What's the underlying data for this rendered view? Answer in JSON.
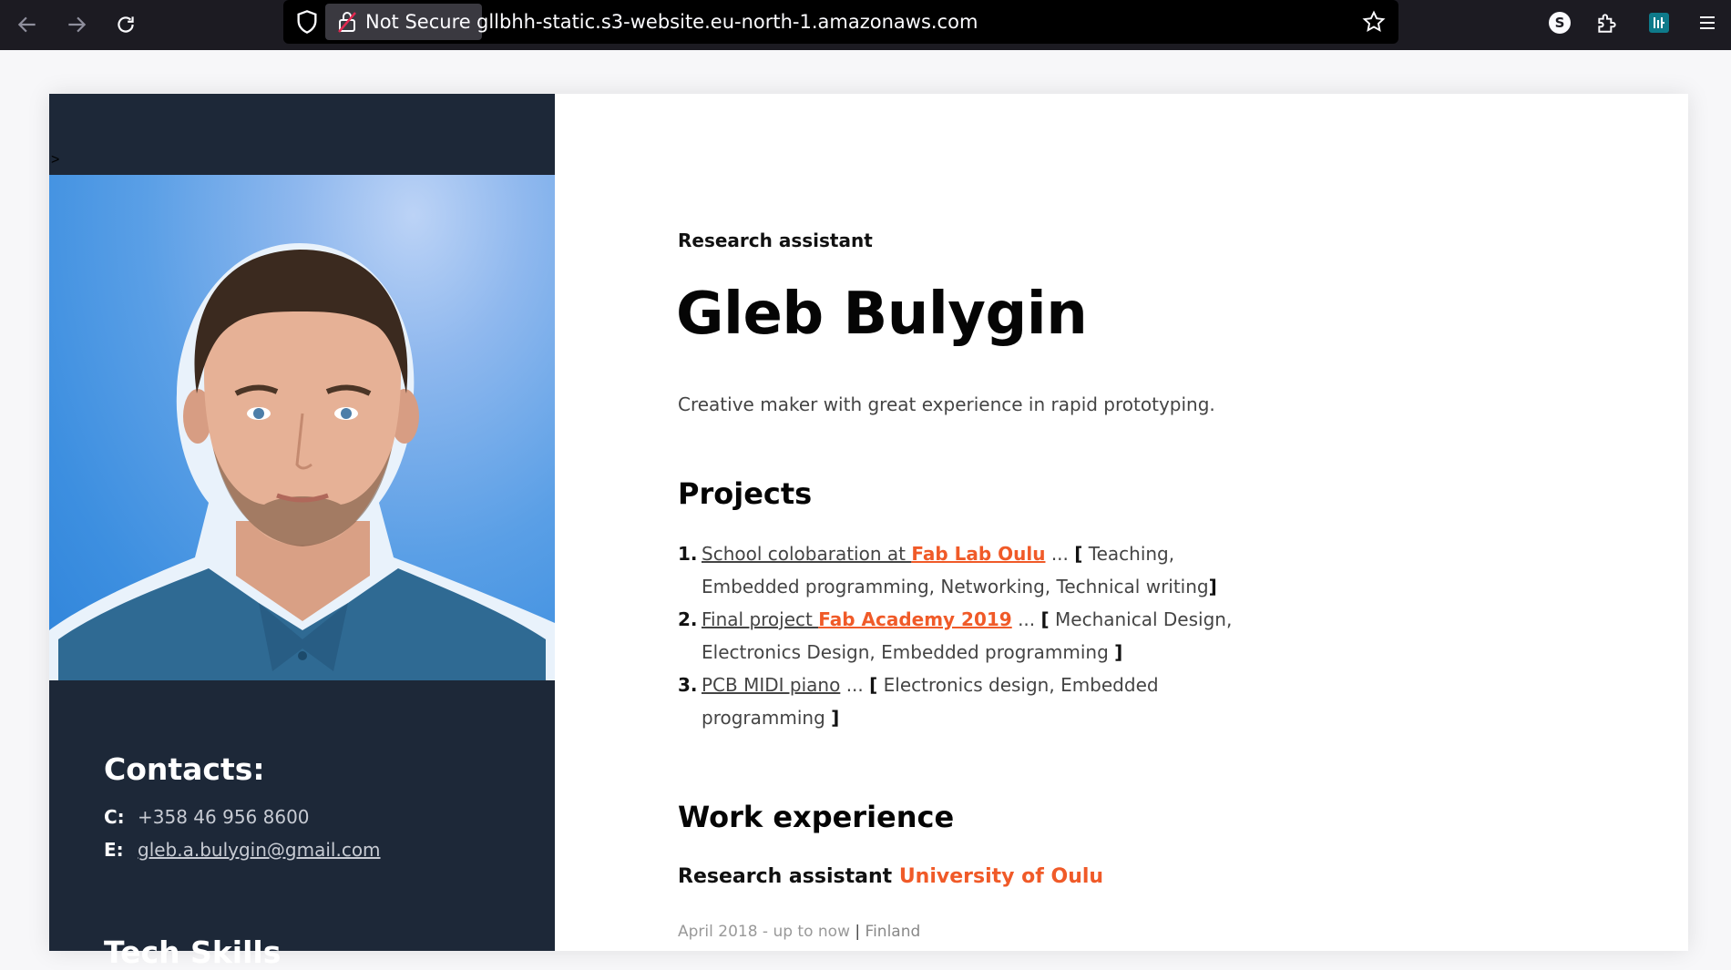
{
  "browser": {
    "not_secure_label": "Not Secure",
    "url": "gllbhh-static.s3-website.eu-north-1.amazonaws.com",
    "profile_initial": "S",
    "colors": {
      "chrome": "#1c1b22",
      "urlbar": "#000000"
    }
  },
  "page": {
    "stray_char": ">",
    "colors": {
      "sidebar": "#1d2838",
      "accent": "#f05a28"
    }
  },
  "sidebar": {
    "contacts_title": "Contacts:",
    "contacts": [
      {
        "key": "C:",
        "value": "+358 46 956 8600"
      },
      {
        "key": "E:",
        "value": "gleb.a.bulygin@gmail.com"
      }
    ],
    "skills_title": "Tech Skills"
  },
  "main": {
    "role": "Research assistant",
    "name": "Gleb Bulygin",
    "tagline": "Creative maker with great experience in rapid prototyping.",
    "projects_title": "Projects",
    "projects": [
      {
        "num": "1.",
        "link": "School colobaration at ",
        "accent": "Fab Lab Oulu",
        "ellipsis": " ... ",
        "open": "[",
        "tags": " Teaching, Embedded programming, Networking, Technical writing",
        "close": "]"
      },
      {
        "num": "2.",
        "link": "Final project ",
        "accent": "Fab Academy 2019",
        "ellipsis": " ... ",
        "open": "[",
        "tags": " Mechanical Design, Electronics Design, Embedded programming ",
        "close": "]"
      },
      {
        "num": "3.",
        "link": "PCB MIDI piano",
        "accent": "",
        "ellipsis": " ... ",
        "open": "[",
        "tags": " Electronics design, Embedded programming ",
        "close": "]"
      }
    ],
    "work_title": "Work experience",
    "job": {
      "title": "Research assistant ",
      "org": "University of Oulu",
      "dates": "April 2018 - up to now",
      "separator": " | ",
      "place": "Finland"
    }
  }
}
